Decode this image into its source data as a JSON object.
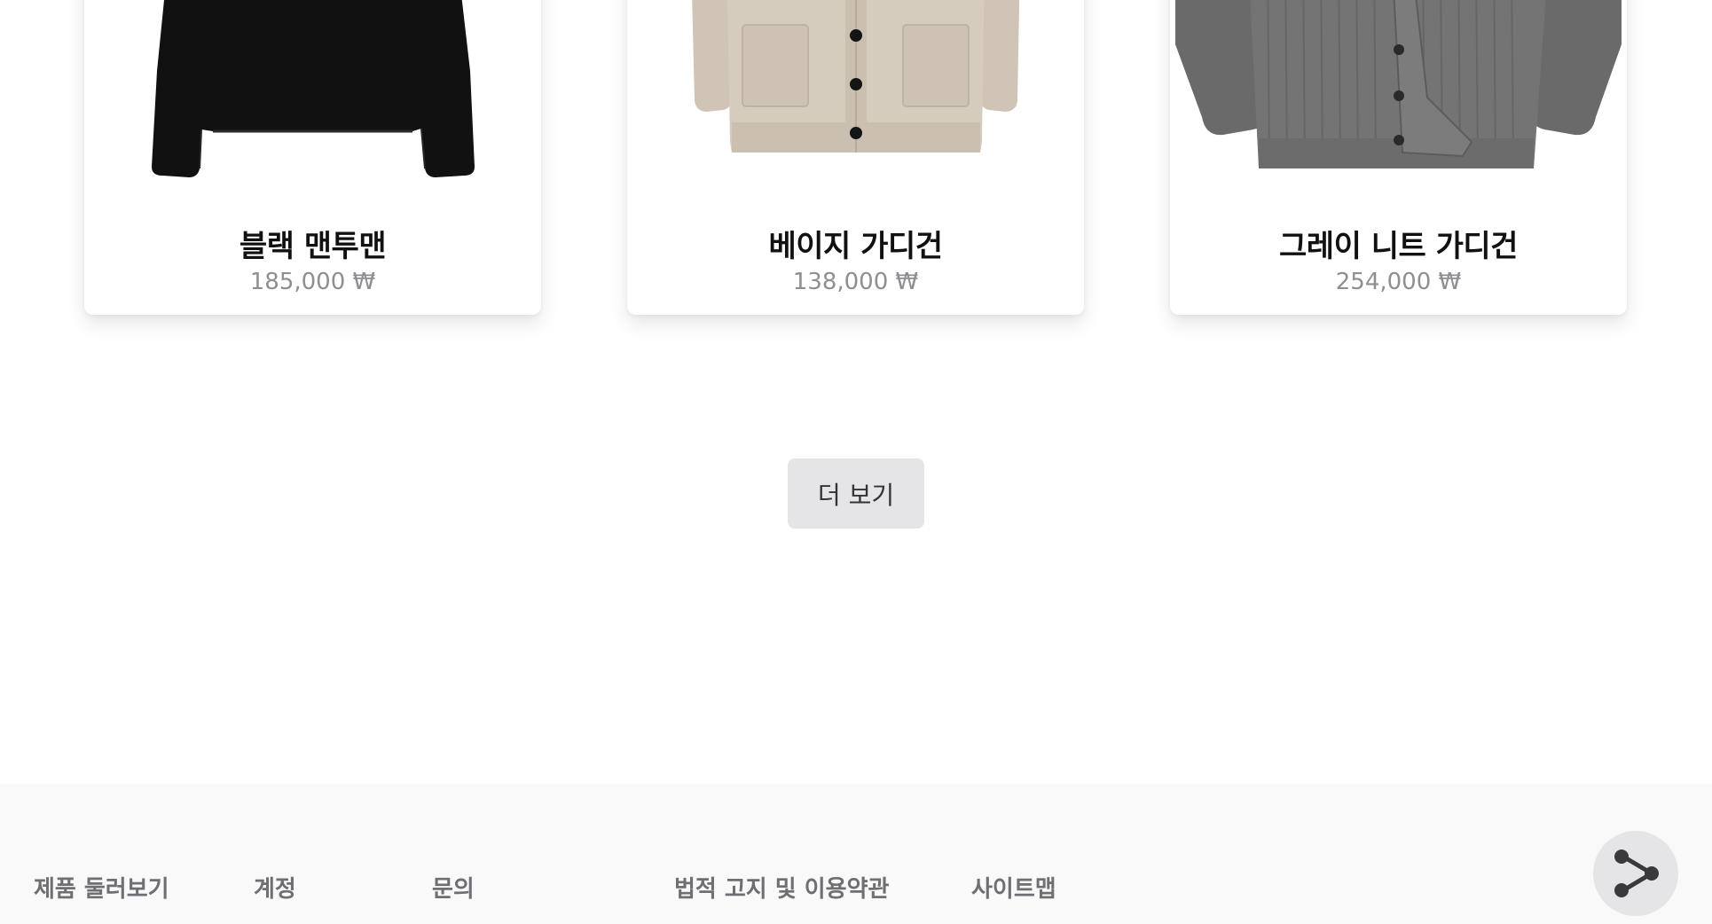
{
  "products": [
    {
      "name": "블랙 맨투맨",
      "price": "185,000 ₩",
      "image": "black-sweatshirt",
      "color": "#111111"
    },
    {
      "name": "베이지 가디건",
      "price": "138,000 ₩",
      "image": "beige-cardigan",
      "color": "#d9cfc2"
    },
    {
      "name": "그레이 니트 가디건",
      "price": "254,000 ₩",
      "image": "gray-knit-cardigan",
      "color": "#6e6e6e"
    }
  ],
  "more_button": {
    "label": "더 보기"
  },
  "footer": {
    "links": [
      "제품 둘러보기",
      "계정",
      "문의",
      "법적 고지 및 이용약관",
      "사이트맵"
    ]
  },
  "share": {
    "icon": "share-icon"
  }
}
